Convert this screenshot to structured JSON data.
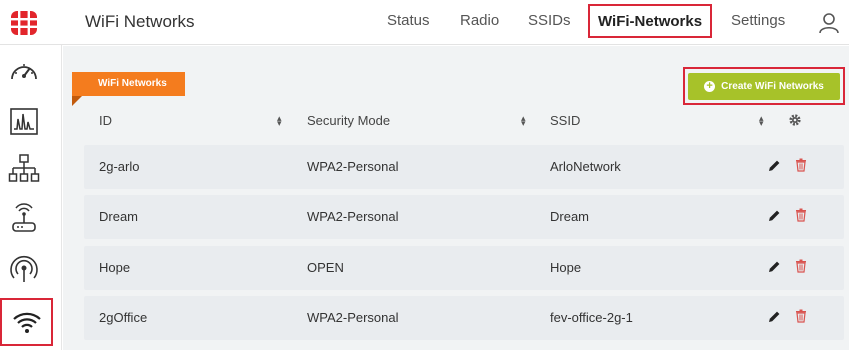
{
  "header": {
    "app_title": "WiFi Networks",
    "nav": [
      {
        "label": "Status",
        "active": false
      },
      {
        "label": "Radio",
        "active": false
      },
      {
        "label": "SSIDs",
        "active": false
      },
      {
        "label": "WiFi-Networks",
        "active": true
      },
      {
        "label": "Settings",
        "active": false
      }
    ],
    "logo_icon": "fortinet-logo",
    "user_icon": "user-icon"
  },
  "sidebar": {
    "items": [
      {
        "icon": "dashboard-gauge-icon",
        "active": false
      },
      {
        "icon": "monitor-chart-icon",
        "active": false
      },
      {
        "icon": "network-topology-icon",
        "active": false
      },
      {
        "icon": "access-point-icon",
        "active": false
      },
      {
        "icon": "radio-signal-icon",
        "active": false
      },
      {
        "icon": "wifi-icon",
        "active": true
      }
    ]
  },
  "main": {
    "section_label": "WiFi Networks",
    "create_button_label": "Create WiFi Networks",
    "columns": [
      "ID",
      "Security Mode",
      "SSID"
    ],
    "rows": [
      {
        "id": "2g-arlo",
        "security": "WPA2-Personal",
        "ssid": "ArloNetwork"
      },
      {
        "id": "Dream",
        "security": "WPA2-Personal",
        "ssid": "Dream"
      },
      {
        "id": "Hope",
        "security": "OPEN",
        "ssid": "Hope"
      },
      {
        "id": "2gOffice",
        "security": "WPA2-Personal",
        "ssid": "fev-office-2g-1"
      }
    ]
  },
  "colors": {
    "accent_orange": "#f47c1e",
    "create_green": "#a7c229",
    "highlight_red": "#d92638",
    "trash_red": "#d9534f"
  }
}
